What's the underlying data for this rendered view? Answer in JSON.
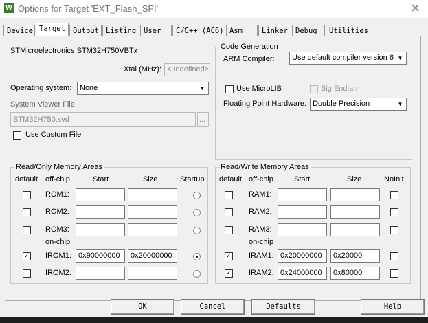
{
  "window": {
    "title": "Options for Target 'EXT_Flash_SPI'",
    "icon": "keil-uvision-icon"
  },
  "tabs": [
    "Device",
    "Target",
    "Output",
    "Listing",
    "User",
    "C/C++ (AC6)",
    "Asm",
    "Linker",
    "Debug",
    "Utilities"
  ],
  "active_tab": "Target",
  "device": "STMicroelectronics STM32H750VBTx",
  "xtal": {
    "label": "Xtal (MHz):",
    "value": "<undefined>"
  },
  "os": {
    "label": "Operating system:",
    "value": "None"
  },
  "svf": {
    "label": "System Viewer File:",
    "value": "STM32H750.svd",
    "browse": "..."
  },
  "custom_file": {
    "label": "Use Custom File",
    "checked": false
  },
  "codegen": {
    "title": "Code Generation",
    "compiler_label": "ARM Compiler:",
    "compiler_value": "Use default compiler version 6",
    "microlib": "Use MicroLIB",
    "bigendian": "Big Endian",
    "fpu_label": "Floating Point Hardware:",
    "fpu_value": "Double Precision"
  },
  "rom": {
    "title": "Read/Only Memory Areas",
    "headers": {
      "default": "default",
      "offchip": "off-chip",
      "start": "Start",
      "size": "Size",
      "extra": "Startup"
    },
    "onchip": "on-chip",
    "rows": [
      {
        "name": "ROM1:",
        "checked": false,
        "start": "",
        "size": "",
        "startup": false
      },
      {
        "name": "ROM2:",
        "checked": false,
        "start": "",
        "size": "",
        "startup": false
      },
      {
        "name": "ROM3:",
        "checked": false,
        "start": "",
        "size": "",
        "startup": false
      },
      {
        "name": "IROM1:",
        "checked": true,
        "start": "0x90000000",
        "size": "0x20000000",
        "startup": true
      },
      {
        "name": "IROM2:",
        "checked": false,
        "start": "",
        "size": "",
        "startup": false
      }
    ]
  },
  "ram": {
    "title": "Read/Write Memory Areas",
    "headers": {
      "default": "default",
      "offchip": "off-chip",
      "start": "Start",
      "size": "Size",
      "extra": "NoInit"
    },
    "onchip": "on-chip",
    "rows": [
      {
        "name": "RAM1:",
        "checked": false,
        "start": "",
        "size": "",
        "noinit": false
      },
      {
        "name": "RAM2:",
        "checked": false,
        "start": "",
        "size": "",
        "noinit": false
      },
      {
        "name": "RAM3:",
        "checked": false,
        "start": "",
        "size": "",
        "noinit": false
      },
      {
        "name": "IRAM1:",
        "checked": true,
        "start": "0x20000000",
        "size": "0x20000",
        "noinit": false
      },
      {
        "name": "IRAM2:",
        "checked": true,
        "start": "0x24000000",
        "size": "0x80000",
        "noinit": false
      }
    ]
  },
  "buttons": {
    "ok": "OK",
    "cancel": "Cancel",
    "defaults": "Defaults",
    "help": "Help"
  }
}
